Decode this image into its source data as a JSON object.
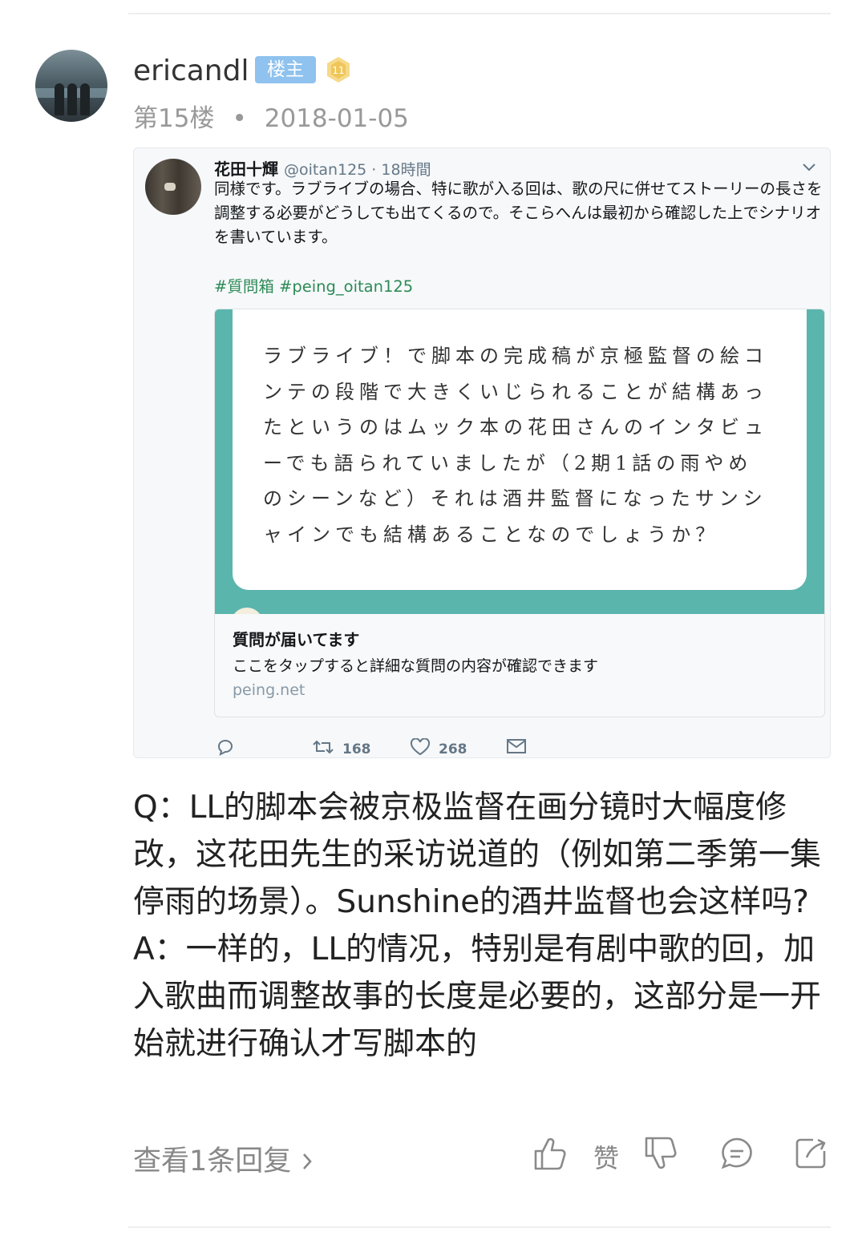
{
  "post": {
    "username": "ericandl",
    "op_badge": "楼主",
    "level": "11",
    "floor": "第15楼",
    "separator": "•",
    "date": "2018-01-05"
  },
  "tweet": {
    "name": "花田十輝",
    "handle": "@oitan125 · 18時間",
    "body": "同様です。ラブライブの場合、特に歌が入る回は、歌の尺に併せてストーリーの長さを調整する必要がどうしても出てくるので。そこらへんは最初から確認した上でシナリオを書いています。",
    "hashtags": "#質問箱 #peing_oitan125",
    "card": {
      "question": "ラブライブ！で脚本の完成稿が京極監督の絵コンテの段階で大きくいじられることが結構あったというのはムック本の花田さんのインタビューでも語られていましたが（2期1話の雨やめのシーンなど）それは酒井監督になったサンシャインでも結構あることなのでしょうか？",
      "title": "質問が届いてます",
      "description": "ここをタップすると詳細な質問の内容が確認できます",
      "domain": "peing.net"
    },
    "retweets": "168",
    "likes": "268"
  },
  "content": {
    "q": "Q：LL的脚本会被京极监督在画分镜时大幅度修改，这花田先生的采访说道的（例如第二季第一集停雨的场景）。Sunshine的酒井监督也会这样吗?",
    "a": "A：一样的，LL的情况，特别是有剧中歌的回，加入歌曲而调整故事的长度是必要的，这部分是一开始就进行确认才写脚本的"
  },
  "footer": {
    "view_replies": "查看1条回复",
    "like_label": "赞"
  },
  "icons": [
    "chevron-down-icon",
    "reply-icon",
    "retweet-icon",
    "heart-icon",
    "dm-icon",
    "chevron-right-icon",
    "thumb-up-icon",
    "thumb-down-icon",
    "comment-icon",
    "share-icon"
  ],
  "colors": {
    "op_badge": "#8fc2ee",
    "level_badge": "#f6d98a",
    "card_teal": "#5ab5ad",
    "hashtag": "#2e8b57"
  }
}
